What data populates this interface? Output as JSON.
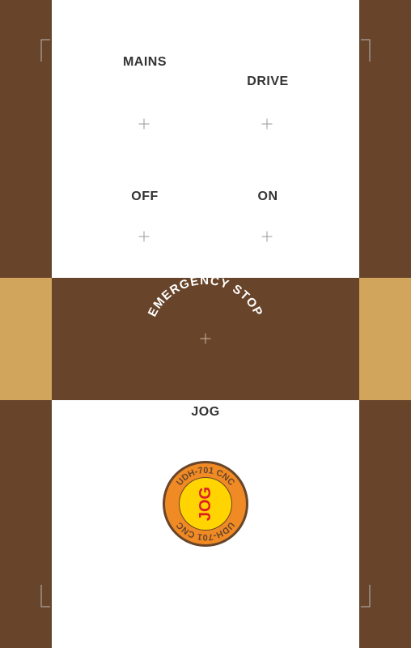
{
  "labels": {
    "mains": "MAINS",
    "drive": "DRIVE",
    "off": "OFF",
    "on": "ON",
    "emergency_stop": "EMERGENCY STOP",
    "jog": "JOG"
  },
  "jog_badge": {
    "ring_text_top": "UDH-701 CNC",
    "ring_text_bottom": "UDH-701 CNC",
    "center_text": "JOG"
  },
  "colors": {
    "frame_brown": "#68452a",
    "accent_tan": "#d1a55b",
    "badge_orange": "#f08a24",
    "badge_yellow": "#ffd400",
    "badge_red": "#e02026"
  }
}
